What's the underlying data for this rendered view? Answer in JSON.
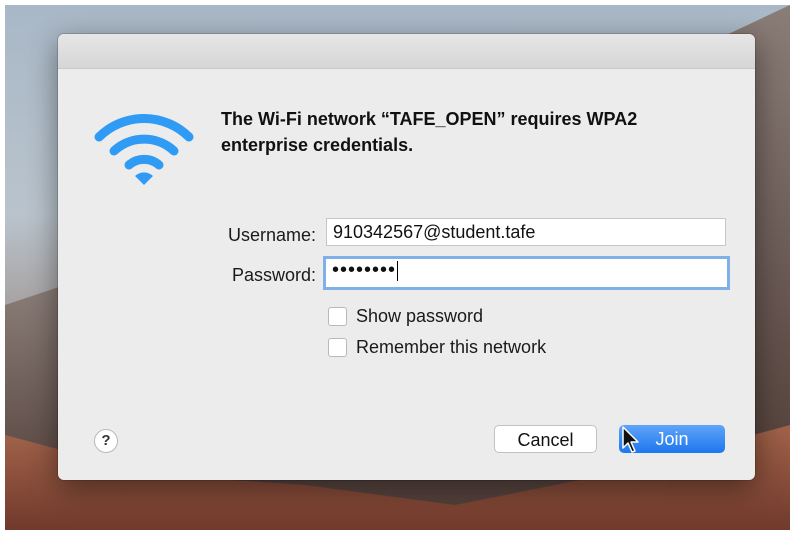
{
  "colors": {
    "accent": "#1d77ef",
    "wifi": "#2f9bf5"
  },
  "dialog": {
    "message": "The Wi-Fi network “TAFE_OPEN” requires WPA2 enterprise credentials.",
    "icon": "wifi-icon"
  },
  "form": {
    "username_label": "Username:",
    "username_value": "910342567@student.tafe",
    "password_label": "Password:",
    "password_value": "••••••••",
    "show_password_label": "Show password",
    "remember_label": "Remember this network"
  },
  "buttons": {
    "help": "?",
    "cancel": "Cancel",
    "join": "Join"
  }
}
